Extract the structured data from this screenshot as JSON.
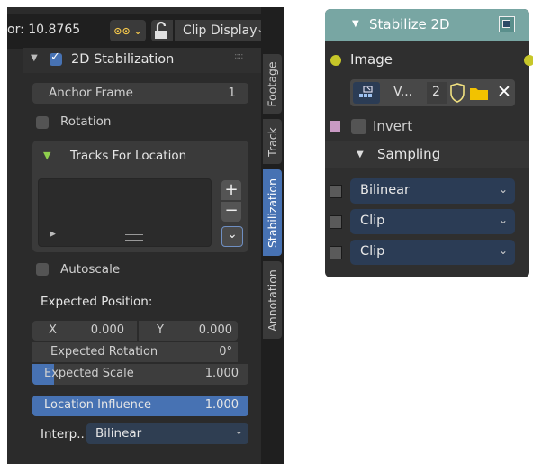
{
  "header": {
    "factor_label": "or: 10.8765",
    "view_menu_glyph": "⊙⊙ ⌄",
    "clip_display_label": "Clip Display",
    "colors": {
      "header_bg": "#1f1f1f",
      "accent": "#4772b3"
    }
  },
  "panel": {
    "title": "2D Stabilization",
    "enabled": true,
    "anchor_frame_label": "Anchor Frame",
    "anchor_frame_value": "1",
    "rotation_label": "Rotation",
    "rotation_checked": false,
    "tracks_for_location_label": "Tracks For Location",
    "list_play_glyph": "▶",
    "list_add_glyph": "+",
    "list_remove_glyph": "−",
    "list_more_glyph": "⌄",
    "autoscale_label": "Autoscale",
    "autoscale_checked": false,
    "expected_position_label": "Expected Position:",
    "x_label": "X",
    "x_value": "0.000",
    "y_label": "Y",
    "y_value": "0.000",
    "expected_rotation_label": "Expected Rotation",
    "expected_rotation_value": "0°",
    "expected_scale_label": "Expected Scale",
    "expected_scale_value": "1.000",
    "expected_scale_fill": 0.1,
    "location_influence_label": "Location Influence",
    "location_influence_value": "1.000",
    "location_influence_fill": 1.0,
    "interp_label": "Interp...",
    "interp_value": "Bilinear"
  },
  "tabs": [
    "Footage",
    "Track",
    "Stabilization",
    "Annotation"
  ],
  "node": {
    "title": "Stabilize 2D",
    "header_color": "#78a6a3",
    "image_label": "Image",
    "clip_short": "V...",
    "clip_users": "2",
    "invert_label": "Invert",
    "invert_checked": false,
    "sampling_label": "Sampling",
    "filter_value": "Bilinear",
    "clip_a_value": "Clip",
    "clip_b_value": "Clip"
  }
}
